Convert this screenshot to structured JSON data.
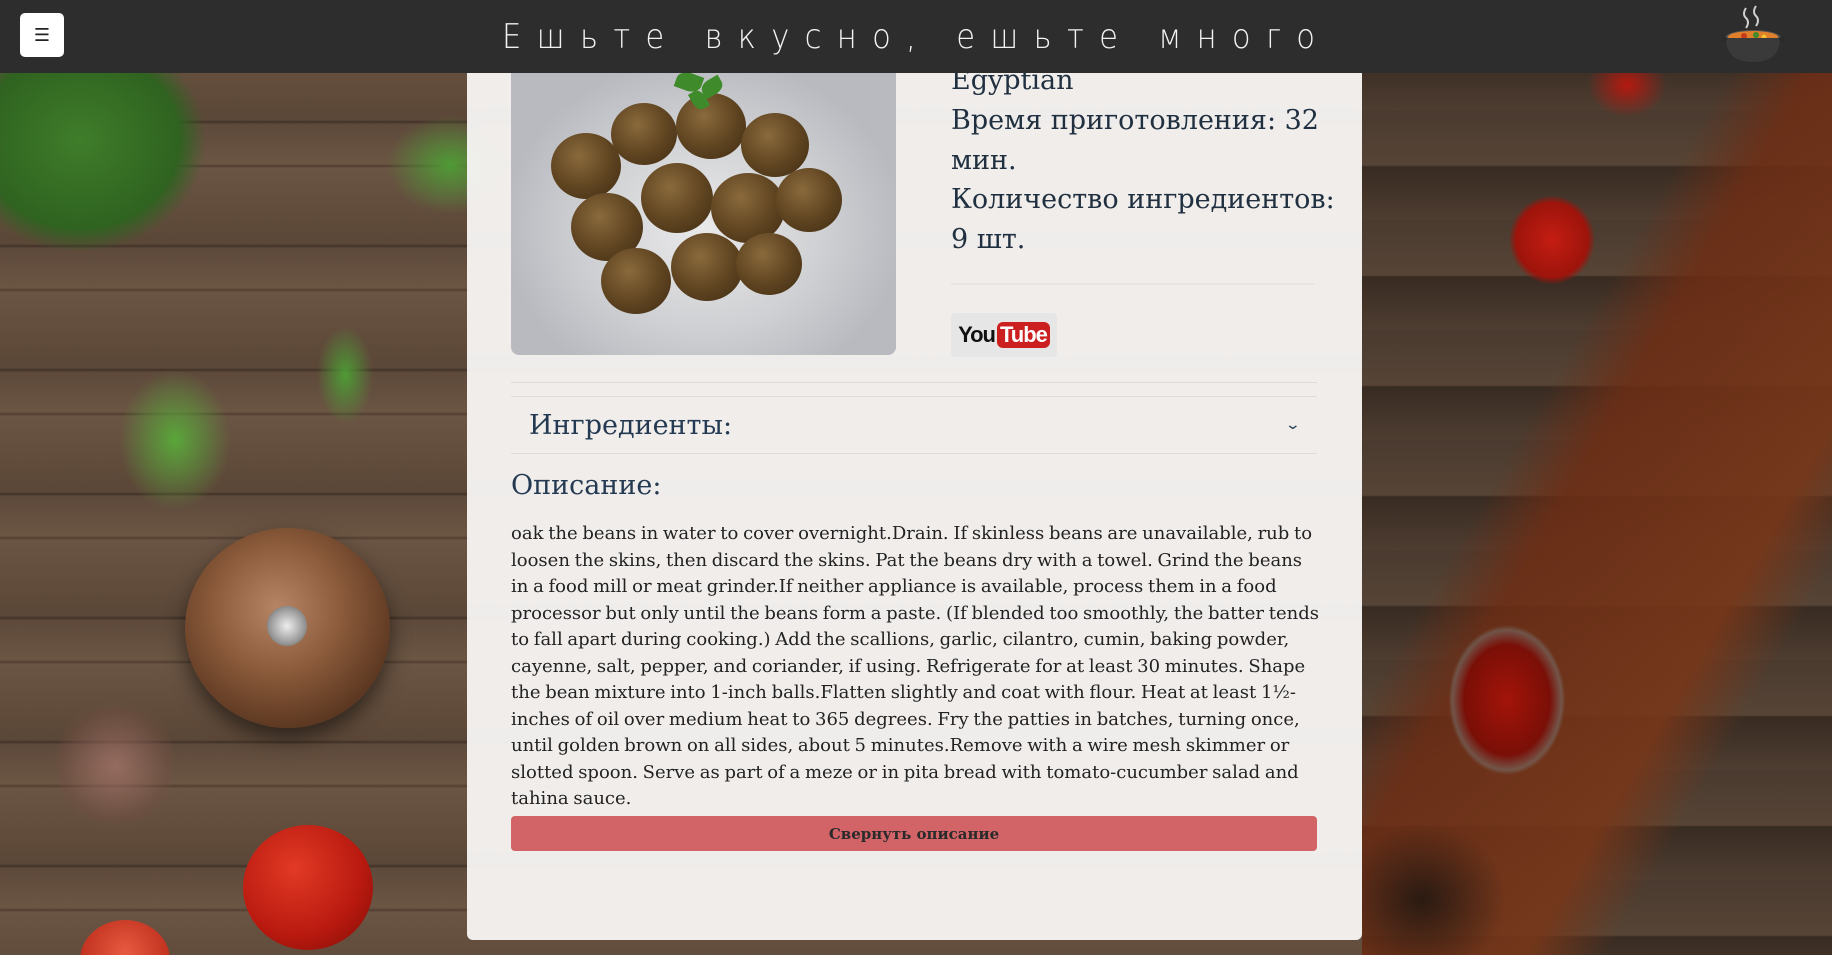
{
  "header": {
    "menu_icon": "☰",
    "title": "Ешьте вкусно, ешьте много",
    "logo_icon": "soup-pot-icon"
  },
  "recipe": {
    "cuisine": "Egyptian",
    "time_label": "Время приготовления: 32 мин.",
    "ingredients_count_label": "Количество ингредиентов: 9 шт.",
    "video_button": {
      "you": "You",
      "tube": "Tube"
    },
    "ingredients_heading": "Ингредиенты:",
    "description_heading": "Описание:",
    "description": "oak the beans in water to cover overnight.Drain. If skinless beans are unavailable, rub to loosen the skins, then discard the skins. Pat the beans dry with a towel. Grind the beans in a food mill or meat grinder.If neither appliance is available, process them in a food processor but only until the beans form a paste. (If blended too smoothly, the batter tends to fall apart during cooking.) Add the scallions, garlic, cilantro, cumin, baking powder, cayenne, salt, pepper, and coriander, if using. Refrigerate for at least 30 minutes. Shape the bean mixture into 1-inch balls.Flatten slightly and coat with flour. Heat at least 1½-inches of oil over medium heat to 365 degrees. Fry the patties in batches, turning once, until golden brown on all sides, about 5 minutes.Remove with a wire mesh skimmer or slotted spoon. Serve as part of a meze or in pita bread with tomato-cucumber salad and tahina sauce.",
    "collapse_button": "Свернуть описание"
  },
  "colors": {
    "header_bg": "#2d2d2d",
    "card_bg": "#f6f4f3",
    "collapse_button_bg": "#d26468",
    "heading_text": "#243a52"
  }
}
